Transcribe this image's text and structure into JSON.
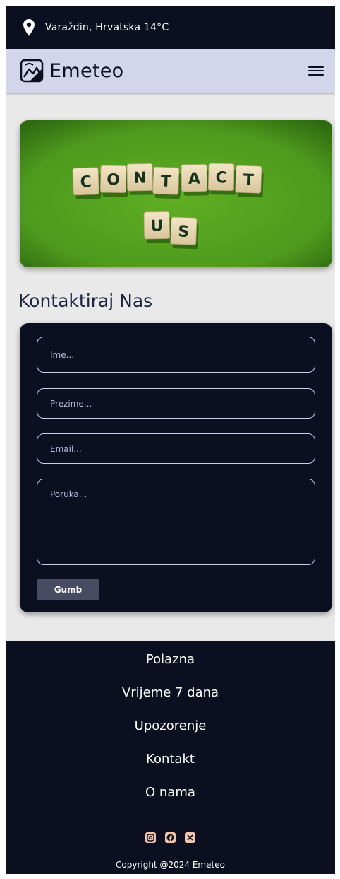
{
  "topbar": {
    "location": "Varaždin, Hrvatska 14°C",
    "icon": "map-pin-icon"
  },
  "navbar": {
    "brand": "Emeteo",
    "logo_icon": "emeteo-logo-icon",
    "menu_icon": "hamburger-menu-icon"
  },
  "hero": {
    "tiles_row1": [
      "C",
      "O",
      "N",
      "T",
      "A",
      "C",
      "T"
    ],
    "tiles_row2": [
      "U",
      "S"
    ],
    "background": "#4e9a1e"
  },
  "page": {
    "title": "Kontaktiraj Nas"
  },
  "form": {
    "ime_placeholder": "Ime...",
    "prezime_placeholder": "Prezime...",
    "email_placeholder": "Email...",
    "poruka_placeholder": "Poruka...",
    "submit_label": "Gumb"
  },
  "footer": {
    "links": [
      "Polazna",
      "Vrijeme 7 dana",
      "Upozorenje",
      "Kontakt",
      "O nama"
    ],
    "socials": [
      "instagram-icon",
      "facebook-icon",
      "x-twitter-icon"
    ],
    "copyright": "Copyright @2024 Emeteo"
  },
  "colors": {
    "dark": "#0b0f1f",
    "navbar": "#d3d6ea",
    "page_bg": "#e9e9e9",
    "button": "#484c62",
    "social": "#f2c6ad"
  }
}
